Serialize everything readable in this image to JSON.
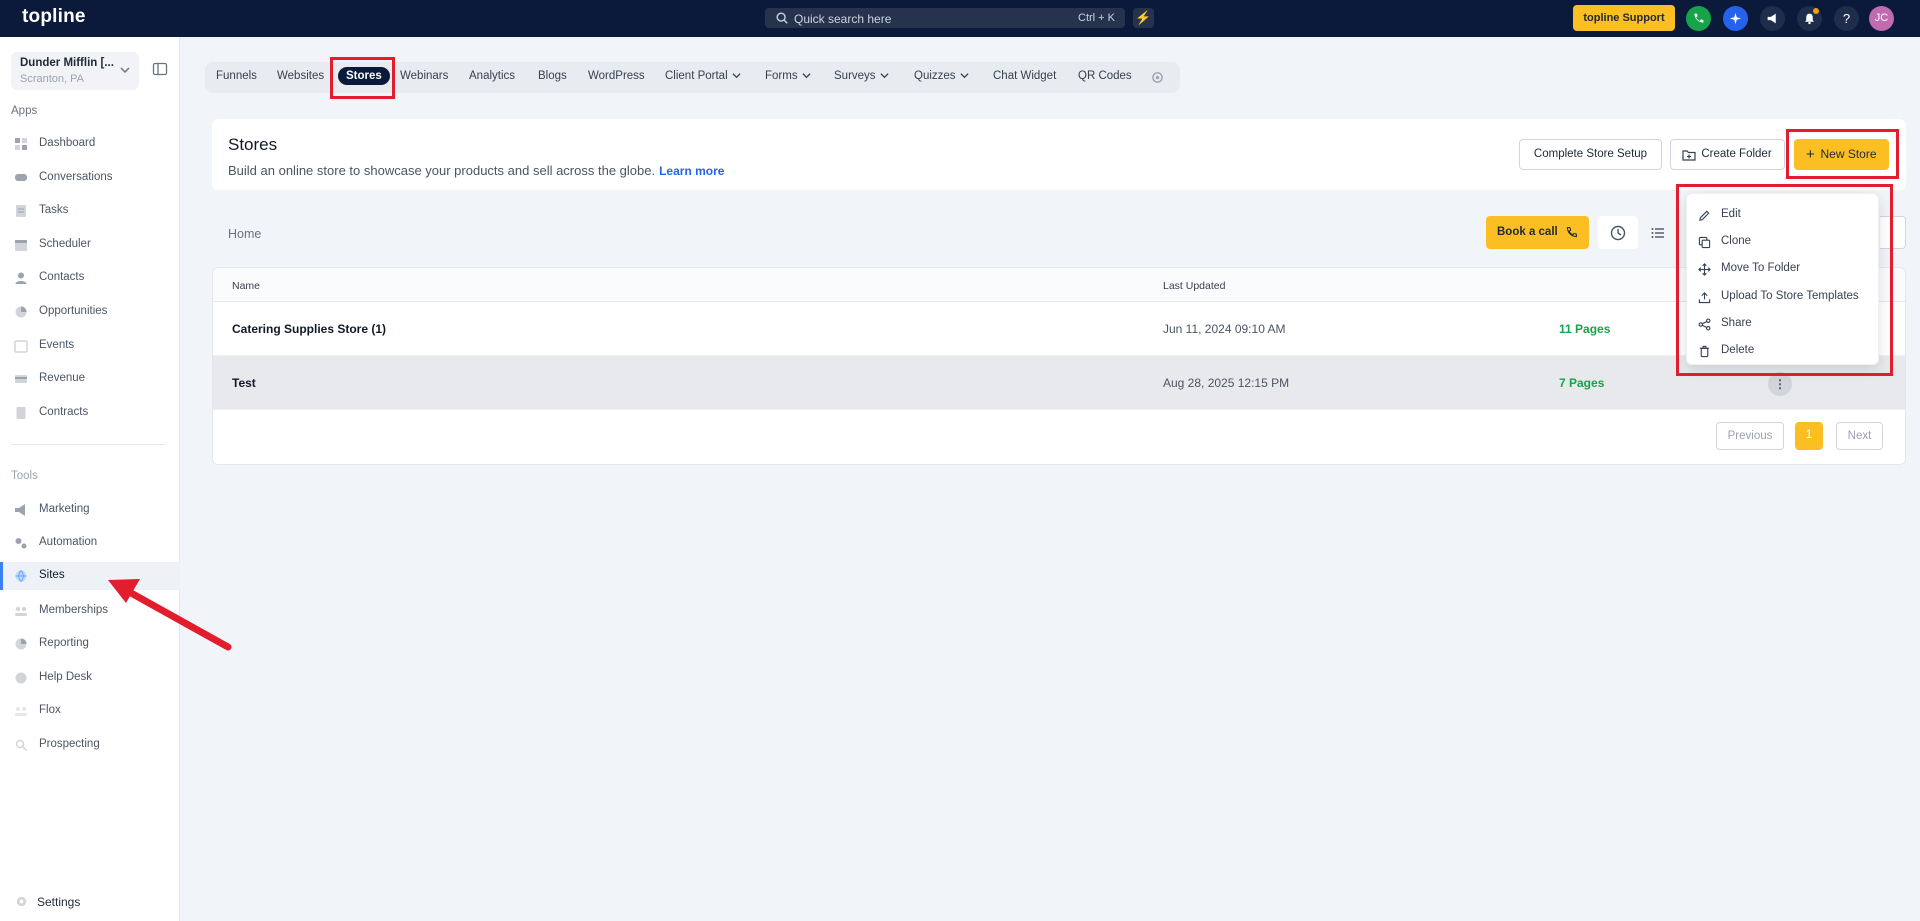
{
  "topbar": {
    "logo": "topline",
    "search_placeholder": "Quick search here",
    "search_shortcut": "Ctrl + K",
    "support_label": "topline Support",
    "avatar_initials": "JC"
  },
  "account": {
    "name": "Dunder Mifflin [...",
    "location": "Scranton, PA"
  },
  "sidebar": {
    "apps_label": "Apps",
    "apps": [
      {
        "label": "Dashboard"
      },
      {
        "label": "Conversations"
      },
      {
        "label": "Tasks"
      },
      {
        "label": "Scheduler"
      },
      {
        "label": "Contacts"
      },
      {
        "label": "Opportunities"
      },
      {
        "label": "Events"
      },
      {
        "label": "Revenue"
      },
      {
        "label": "Contracts"
      }
    ],
    "tools_label": "Tools",
    "tools": [
      {
        "label": "Marketing"
      },
      {
        "label": "Automation"
      },
      {
        "label": "Sites"
      },
      {
        "label": "Memberships"
      },
      {
        "label": "Reporting"
      },
      {
        "label": "Help Desk"
      },
      {
        "label": "Flox"
      },
      {
        "label": "Prospecting"
      }
    ],
    "settings_label": "Settings"
  },
  "tabs": [
    {
      "label": "Funnels"
    },
    {
      "label": "Websites"
    },
    {
      "label": "Stores"
    },
    {
      "label": "Webinars"
    },
    {
      "label": "Analytics"
    },
    {
      "label": "Blogs"
    },
    {
      "label": "WordPress"
    },
    {
      "label": "Client Portal"
    },
    {
      "label": "Forms"
    },
    {
      "label": "Surveys"
    },
    {
      "label": "Quizzes"
    },
    {
      "label": "Chat Widget"
    },
    {
      "label": "QR Codes"
    }
  ],
  "header": {
    "title": "Stores",
    "description": "Build an online store to showcase your products and sell across the globe.",
    "learn_more": "Learn more",
    "complete_setup": "Complete Store Setup",
    "create_folder": "Create Folder",
    "new_store": "New Store"
  },
  "toolbar": {
    "breadcrumb": "Home",
    "book_call": "Book a call"
  },
  "table": {
    "headers": {
      "name": "Name",
      "last_updated": "Last Updated"
    },
    "rows": [
      {
        "name": "Catering Supplies Store (1)",
        "updated": "Jun 11, 2024 09:10 AM",
        "pages": "11 Pages"
      },
      {
        "name": "Test",
        "updated": "Aug 28, 2025 12:15 PM",
        "pages": "7 Pages"
      }
    ],
    "pagination": {
      "previous": "Previous",
      "current": "1",
      "next": "Next"
    }
  },
  "menu": [
    {
      "label": "Edit"
    },
    {
      "label": "Clone"
    },
    {
      "label": "Move To Folder"
    },
    {
      "label": "Upload To Store Templates"
    },
    {
      "label": "Share"
    },
    {
      "label": "Delete"
    }
  ],
  "colors": {
    "topbar": "#0b1a3a",
    "accent_yellow": "#fbbf24",
    "link_blue": "#2563eb",
    "pages_green": "#16a34a",
    "annotation_red": "#e11d2e"
  }
}
